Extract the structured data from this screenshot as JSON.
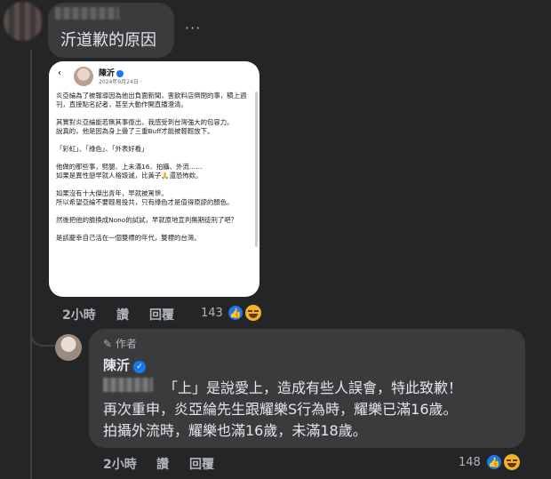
{
  "top_comment": {
    "text": "沂道歉的原因",
    "more_label": "···",
    "image": {
      "back_icon": "‹",
      "author": "陳沂",
      "date": "2024年9月24日 ·",
      "paragraphs": [
        "炎亞綸為了被報導因為他出負面新聞，害飲料店倒閉的事，積上週刊，直接點名記者，甚至大動作開直播澄清。",
        "其實對炎亞綸能若無其事復出，我感受到台灣強大的包容力。\n說真的，他是因為身上疊了三重Buff才能被輕輕放下。",
        "「彩虹」、「綠色」、「外表好看」",
        "他做的那些事，劈腿、上未滿16、拍攝、外流……\n如果是異性戀早就人格毀滅，比黃子🙏還恐怖欸。",
        "如果沒有十大傑出青年，早就被罵慘。\n所以希望亞綸不要輕易投共，只有綠色才是值得原諒的顏色。",
        "然後把他的臉換成Nono的試試，早就原地宣判無期徒刑了吧？",
        "是該慶幸自己活在一個雙標的年代，雙標的台灣。"
      ]
    },
    "actions": {
      "time": "2小時",
      "like": "讚",
      "reply": "回覆"
    },
    "reaction_count": "143"
  },
  "reply_comment": {
    "author_badge": "作者",
    "name": "陳沂",
    "lines": [
      "「上」是說愛上，造成有些人誤會，特此致歉！",
      "再次重申，炎亞綸先生跟耀樂S行為時，耀樂已滿16歲。",
      "拍攝外流時，耀樂也滿16歲，未滿18歲。"
    ],
    "actions": {
      "time": "2小時",
      "like": "讚",
      "reply": "回覆"
    },
    "reaction_count": "148"
  },
  "colors": {
    "background": "#242526",
    "bubble": "#3a3b3c",
    "text": "#e4e6eb",
    "muted": "#b0b3b8",
    "like_blue": "#1877f2",
    "haha_yellow": "#f7b125"
  },
  "icons": {
    "verified": "verified-check-icon",
    "pencil": "pencil-icon",
    "like_reaction": "like-reaction-icon",
    "haha_reaction": "haha-reaction-icon"
  }
}
